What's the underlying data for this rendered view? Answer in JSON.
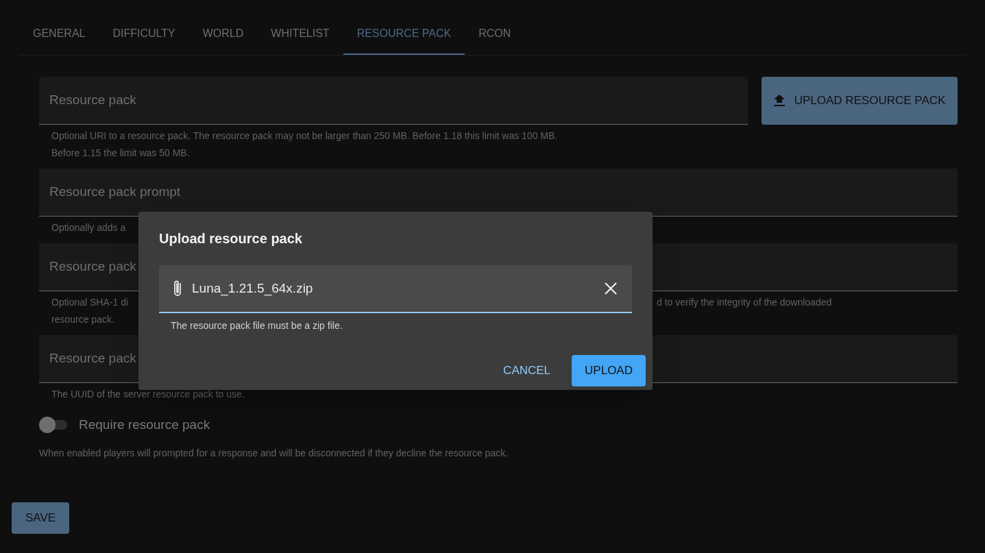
{
  "tabs": [
    {
      "label": "GENERAL",
      "selected": false
    },
    {
      "label": "DIFFICULTY",
      "selected": false
    },
    {
      "label": "WORLD",
      "selected": false
    },
    {
      "label": "WHITELIST",
      "selected": false
    },
    {
      "label": "RESOURCE PACK",
      "selected": true
    },
    {
      "label": "RCON",
      "selected": false
    }
  ],
  "fields": [
    {
      "label": "Resource pack",
      "helper_lines": [
        [
          "Optional URI to a resource pack. The resource pack may not be larger than 250 MB. Before 1.18 this limit was 100 MB."
        ],
        [
          "Before 1.15 the limit was 50 MB."
        ]
      ]
    },
    {
      "label": "Resource pack prompt",
      "helper_lines": [
        [
          "Optionally adds a"
        ]
      ]
    },
    {
      "label": "Resource pack",
      "helper_lines": [
        [
          "Optional SHA-1 di",
          "d to verify the integrity of the downloaded"
        ],
        [
          "resource pack."
        ]
      ]
    },
    {
      "label": "Resource pack",
      "helper_lines": [
        [
          "The UUID of the server resource pack to use."
        ]
      ]
    }
  ],
  "upload_button": {
    "label": "UPLOAD RESOURCE PACK"
  },
  "require_toggle": {
    "label": "Require resource pack",
    "on": false,
    "helper": "When enabled players will prompted for a response and will be disconnected if they decline the resource pack."
  },
  "save_button": {
    "label": "SAVE"
  },
  "dialog": {
    "title": "Upload resource pack",
    "file_field": {
      "value": "Luna_1.21.5_64x.zip",
      "helper": "The resource pack file must be a zip file."
    },
    "buttons": [
      {
        "label": "CANCEL",
        "kind": "text"
      },
      {
        "label": "UPLOAD",
        "kind": "contained"
      }
    ]
  }
}
